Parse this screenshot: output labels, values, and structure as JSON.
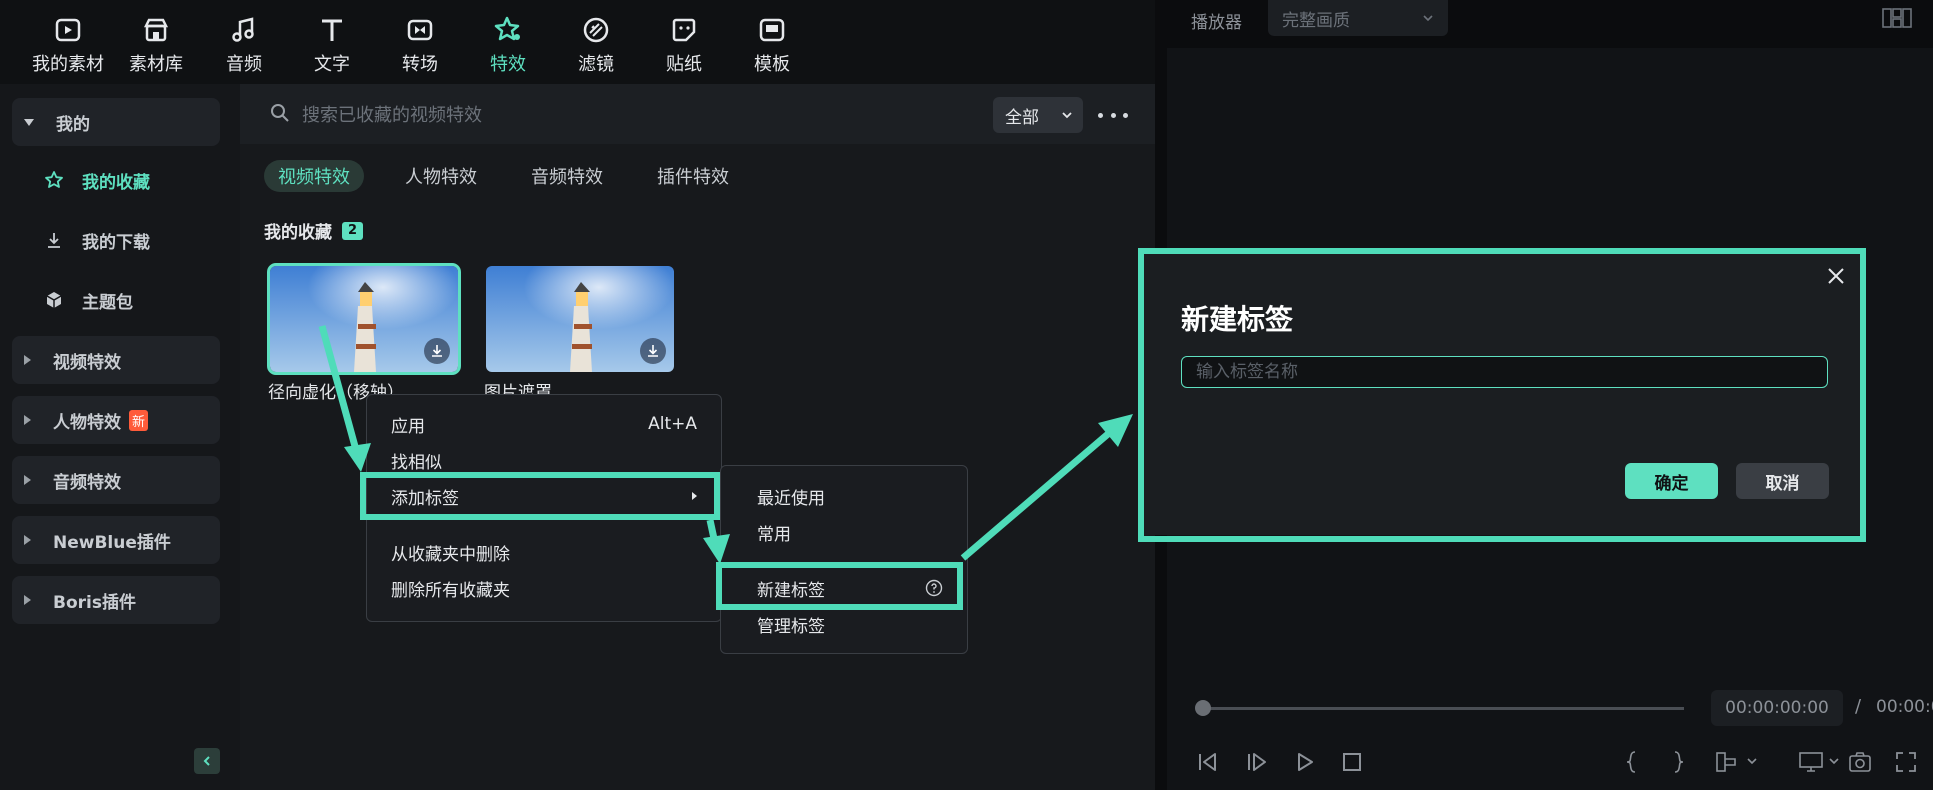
{
  "colors": {
    "accent": "#5ee0c0",
    "highlight": "#4fdcb9",
    "new_badge": "#ff5b3a"
  },
  "top_tabs": [
    {
      "label": "我的素材",
      "icon": "media-icon"
    },
    {
      "label": "素材库",
      "icon": "store-icon"
    },
    {
      "label": "音频",
      "icon": "music-icon"
    },
    {
      "label": "文字",
      "icon": "text-icon"
    },
    {
      "label": "转场",
      "icon": "transition-icon"
    },
    {
      "label": "特效",
      "icon": "effects-icon",
      "active": true
    },
    {
      "label": "滤镜",
      "icon": "filter-icon"
    },
    {
      "label": "贴纸",
      "icon": "sticker-icon"
    },
    {
      "label": "模板",
      "icon": "template-icon"
    }
  ],
  "sidebar": {
    "my_group": "我的",
    "items": [
      "我的收藏",
      "我的下载",
      "主题包"
    ],
    "groups": [
      "视频特效",
      "人物特效",
      "音频特效",
      "NewBlue插件",
      "Boris插件"
    ],
    "new_badge": "新"
  },
  "search": {
    "placeholder": "搜索已收藏的视频特效",
    "filter_value": "全部"
  },
  "category_tabs": [
    "视频特效",
    "人物特效",
    "音频特效",
    "插件特效"
  ],
  "section": {
    "title": "我的收藏",
    "count": "2"
  },
  "thumbnails": [
    {
      "label": "径向虚化（移轴）"
    },
    {
      "label": "图片遮罩"
    }
  ],
  "context_menu": {
    "apply": "应用",
    "apply_shortcut": "Alt+A",
    "find_similar": "找相似",
    "add_tag": "添加标签",
    "remove_from_favorites": "从收藏夹中删除",
    "delete_all_favorites": "删除所有收藏夹"
  },
  "submenu": {
    "recent": "最近使用",
    "common": "常用",
    "new_tag": "新建标签",
    "manage_tags": "管理标签"
  },
  "player": {
    "label": "播放器",
    "quality": "完整画质",
    "timecode": "00:00:00:00",
    "separator": "/",
    "total": "00:00:0"
  },
  "dialog": {
    "title": "新建标签",
    "placeholder": "输入标签名称",
    "ok": "确定",
    "cancel": "取消"
  }
}
